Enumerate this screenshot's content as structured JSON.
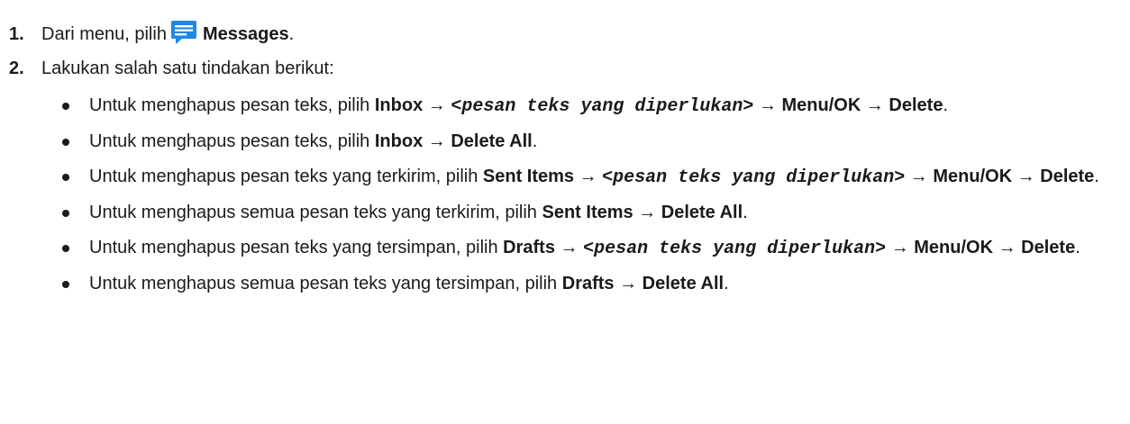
{
  "steps": [
    {
      "num": "1.",
      "text_before": "Dari menu, pilih",
      "icon": "messages-icon",
      "bold": "Messages",
      "text_after": "."
    },
    {
      "num": "2.",
      "text": "Lakukan salah satu tindakan berikut:"
    }
  ],
  "bullets": [
    [
      [
        "t",
        "Untuk menghapus pesan teks, pilih "
      ],
      [
        "b",
        "Inbox"
      ],
      [
        "t",
        " → "
      ],
      [
        "m",
        "<pesan teks yang diperlukan>"
      ],
      [
        "t",
        " → "
      ],
      [
        "b",
        "Menu/OK"
      ],
      [
        "t",
        " → "
      ],
      [
        "b",
        "Delete"
      ],
      [
        "t",
        "."
      ]
    ],
    [
      [
        "t",
        "Untuk menghapus pesan teks, pilih "
      ],
      [
        "b",
        "Inbox"
      ],
      [
        "t",
        " → "
      ],
      [
        "b",
        "Delete All"
      ],
      [
        "t",
        "."
      ]
    ],
    [
      [
        "t",
        "Untuk menghapus pesan teks yang terkirim, pilih "
      ],
      [
        "b",
        "Sent Items"
      ],
      [
        "t",
        " → "
      ],
      [
        "m",
        "<pesan teks yang diperlukan>"
      ],
      [
        "t",
        " → "
      ],
      [
        "b",
        "Menu/OK"
      ],
      [
        "t",
        " → "
      ],
      [
        "b",
        "Delete"
      ],
      [
        "t",
        "."
      ]
    ],
    [
      [
        "t",
        "Untuk menghapus semua pesan teks yang terkirim, pilih "
      ],
      [
        "b",
        "Sent Items"
      ],
      [
        "t",
        " → "
      ],
      [
        "b",
        "Delete All"
      ],
      [
        "t",
        "."
      ]
    ],
    [
      [
        "t",
        "Untuk menghapus pesan teks yang tersimpan, pilih "
      ],
      [
        "b",
        "Drafts"
      ],
      [
        "t",
        " → "
      ],
      [
        "m",
        "<pesan teks yang diperlukan>"
      ],
      [
        "t",
        " → "
      ],
      [
        "b",
        "Menu/OK"
      ],
      [
        "t",
        " → "
      ],
      [
        "b",
        "Delete"
      ],
      [
        "t",
        "."
      ]
    ],
    [
      [
        "t",
        "Untuk menghapus semua pesan teks yang tersimpan, pilih "
      ],
      [
        "b",
        "Drafts"
      ],
      [
        "t",
        " → "
      ],
      [
        "b",
        "Delete All"
      ],
      [
        "t",
        "."
      ]
    ]
  ],
  "colors": {
    "icon_blue": "#1e88e5",
    "text": "#1a1a1a"
  }
}
